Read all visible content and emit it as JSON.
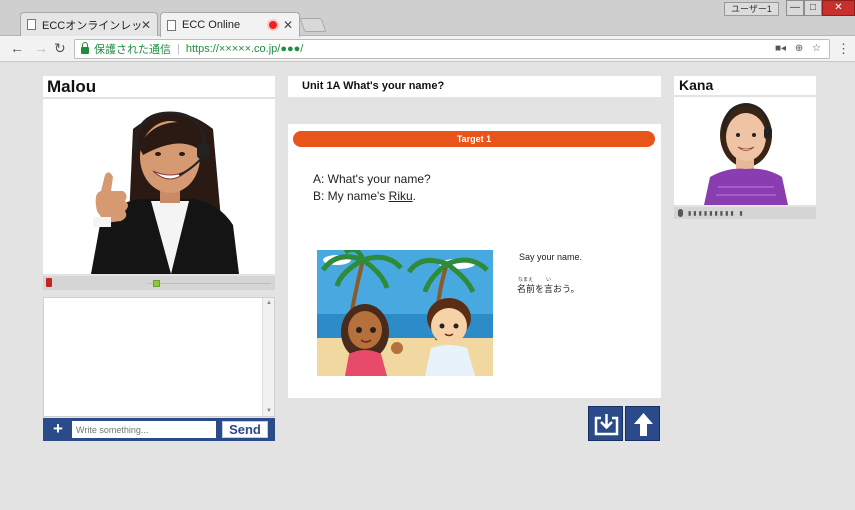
{
  "browser": {
    "tabs": [
      {
        "title": "ECCオンラインレッスン"
      },
      {
        "title": "ECC Online"
      }
    ],
    "user_badge": "ユーザー1",
    "url": {
      "secure_label": "保護された通信",
      "text": "https://×××××.co.jp/●●●/"
    }
  },
  "teacher": {
    "name": "Malou"
  },
  "student": {
    "name": "Kana"
  },
  "chat": {
    "input_placeholder": "Write something...",
    "send_label": "Send",
    "add_label": "+"
  },
  "lesson": {
    "unit_title": "Unit 1A What's your name?",
    "target_label": "Target 1",
    "line_a": "A: What's your name?",
    "line_b_prefix": "B: My name's ",
    "line_b_name": "Riku",
    "line_b_suffix": ".",
    "prompt_en": "Say your name.",
    "prompt_ja": "名前を言おう。",
    "ruby_na": "なまえ",
    "ruby_i": "い"
  },
  "colors": {
    "accent_orange": "#e8541a",
    "nav_blue": "#2a4a8a",
    "secure_green": "#1e8e3e"
  },
  "icons": {
    "download": "download-icon",
    "upload": "arrow-up-icon",
    "mic": "mic-icon",
    "speaker": "speaker-icon"
  }
}
